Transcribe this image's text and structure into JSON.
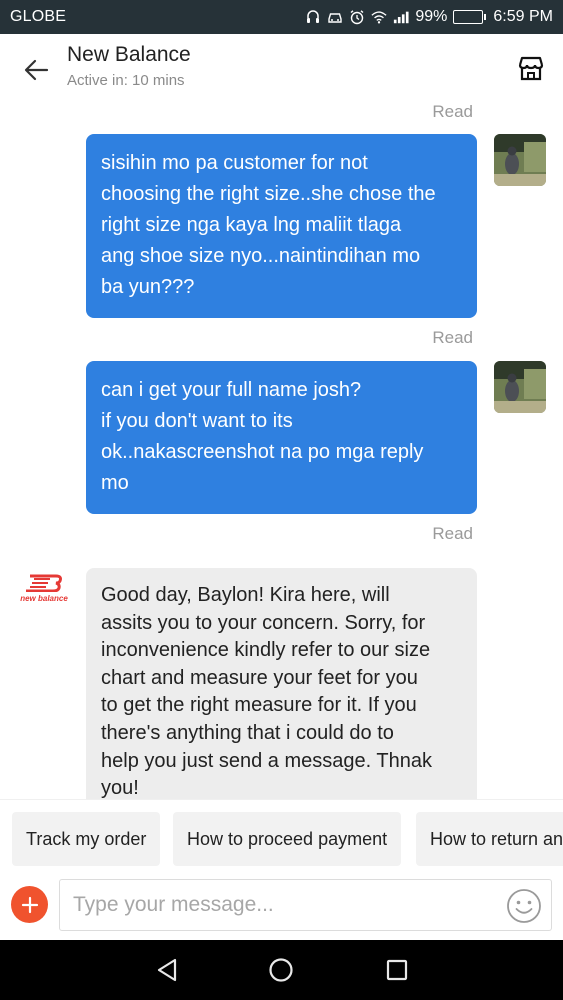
{
  "status_bar": {
    "carrier": "GLOBE",
    "battery": "99%",
    "battery_level": 0.99,
    "time": "6:59 PM",
    "icons": [
      "headset-icon",
      "car-icon",
      "alarm-icon",
      "wifi-icon",
      "signal-icon",
      "battery-icon"
    ]
  },
  "header": {
    "title": "New Balance",
    "subtitle": "Active in: 10 mins",
    "back_icon": "arrow-left-icon",
    "store_icon": "store-icon"
  },
  "messages": [
    {
      "direction": "outgoing",
      "status": "Read"
    },
    {
      "direction": "outgoing",
      "lines": [
        "sisihin mo pa customer for not",
        "choosing the right size..she chose the",
        "right size nga kaya lng maliit tlaga",
        "ang shoe size nyo...naintindihan mo",
        "ba yun???"
      ],
      "status": "Read"
    },
    {
      "direction": "outgoing",
      "lines": [
        "can i get your full name josh?",
        "if you don't want to its",
        "ok..nakascreenshot na po mga reply",
        "mo"
      ],
      "status": "Read"
    },
    {
      "direction": "incoming",
      "sender_logo_text": "new balance",
      "lines": [
        "Good day, Baylon! Kira here, will",
        "assits you to your concern. Sorry, for",
        "inconvenience kindly refer to our size",
        "chart and measure your feet for you",
        "to get the right  measure for it. If you",
        "there's anything that i could do to",
        "help you just send a message. Thnak",
        "you!"
      ]
    }
  ],
  "quick_replies": [
    "Track my order",
    "How to proceed payment",
    "How to return an"
  ],
  "composer": {
    "placeholder": "Type your message...",
    "plus_icon": "plus-icon",
    "emoji_icon": "emoji-icon"
  },
  "nav_bar": {
    "icons": [
      "back-triangle-icon",
      "home-circle-icon",
      "recents-square-icon"
    ]
  },
  "colors": {
    "status_bar_bg": "#263238",
    "outgoing_bubble": "#2f80e0",
    "incoming_bubble": "#ededed",
    "brand_red": "#e53935",
    "plus_button": "#f0532e"
  }
}
